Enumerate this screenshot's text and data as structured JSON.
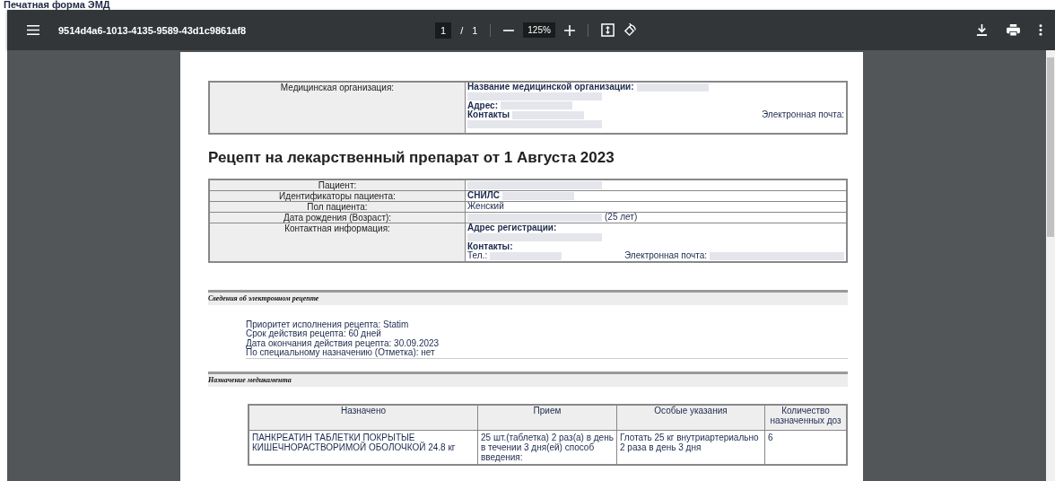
{
  "page_heading": "Печатная форма ЭМД",
  "toolbar": {
    "file_name": "9514d4a6-1013-4135-9589-43d1c9861af8",
    "page_current": "1",
    "page_separator": "/",
    "page_total": "1",
    "zoom": "125%"
  },
  "document": {
    "organization": {
      "label": "Медицинская организация:",
      "lines": [
        [
          {
            "kind": "label",
            "text": "Название медицинской организации:"
          },
          {
            "kind": "redacted"
          }
        ],
        [
          {
            "kind": "redacted"
          }
        ],
        [
          {
            "kind": "label",
            "text": "Адрес:"
          },
          {
            "kind": "redacted"
          }
        ],
        [
          {
            "kind": "label",
            "text": "Контакты"
          },
          {
            "kind": "redacted"
          },
          {
            "kind": "spacer"
          },
          {
            "kind": "text",
            "text": "Электронная почта:"
          }
        ],
        [
          {
            "kind": "redacted"
          }
        ]
      ]
    },
    "title": "Рецепт на лекарственный препарат от 1 Августа 2023",
    "patient_rows": [
      {
        "label": "Пациент:",
        "lines": [
          [
            {
              "kind": "redacted"
            }
          ]
        ]
      },
      {
        "label": "Идентификаторы пациента:",
        "lines": [
          [
            {
              "kind": "label",
              "text": "СНИЛС"
            },
            {
              "kind": "redacted"
            }
          ]
        ]
      },
      {
        "label": "Пол пациента:",
        "lines": [
          [
            {
              "kind": "text",
              "text": "Женский"
            }
          ]
        ]
      },
      {
        "label": "Дата рождения (Возраст):",
        "lines": [
          [
            {
              "kind": "redacted"
            },
            {
              "kind": "text",
              "text": "(25 лет)"
            }
          ]
        ]
      },
      {
        "label": "Контактная информация:",
        "lines": [
          [
            {
              "kind": "label",
              "text": "Адрес регистрации:"
            }
          ],
          [
            {
              "kind": "redacted"
            }
          ],
          [
            {
              "kind": "label",
              "text": "Контакты:"
            }
          ],
          [
            {
              "kind": "text",
              "text": "Тел.:"
            },
            {
              "kind": "redacted"
            },
            {
              "kind": "spacer"
            },
            {
              "kind": "text",
              "text": "Электронная почта:"
            },
            {
              "kind": "redacted"
            }
          ]
        ]
      }
    ],
    "prescription_section": {
      "title": "Сведения об электронном рецепте",
      "lines": [
        "Приоритет исполнения рецепта: Statim",
        "Срок действия рецепта: 60 дней",
        "Дата окончания действия рецепта: 30.09.2023",
        "По специальному назначению (Отметка): нет"
      ]
    },
    "medication_section": {
      "title": "Назначение медикамента",
      "columns": [
        "Назначено",
        "Прием",
        "Особые указания",
        "Количество назначенных доз"
      ],
      "rows": [
        [
          "ПАНКРЕАТИН ТАБЛЕТКИ ПОКРЫТЫЕ КИШЕЧНОРАСТВОРИМОЙ ОБОЛОЧКОЙ 24.8 кг",
          "25 шт.(таблетка) 2 раз(а) в день в течении 3 дня(ей) способ введения:",
          "Глотать 25 кг внутриартериально 2 раза в день 3 дня",
          "6"
        ]
      ]
    }
  }
}
